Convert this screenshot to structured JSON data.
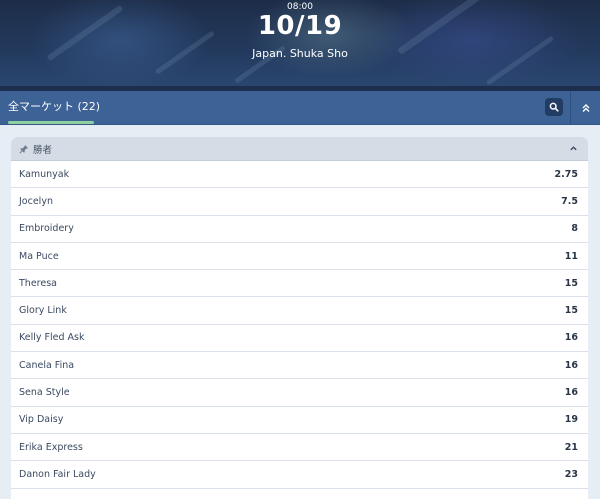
{
  "event": {
    "time": "08:00",
    "date": "10/19",
    "title": "Japan. Shuka Sho"
  },
  "market_bar": {
    "tab_label": "全マーケット (22)",
    "search_icon": "search-icon",
    "collapse_icon": "double-chevron-up-icon"
  },
  "group": {
    "pin_icon": "pin-icon",
    "title": "勝者",
    "toggle_icon": "chevron-up-icon",
    "rows": [
      {
        "name": "Kamunyak",
        "odds": "2.75"
      },
      {
        "name": "Jocelyn",
        "odds": "7.5"
      },
      {
        "name": "Embroidery",
        "odds": "8"
      },
      {
        "name": "Ma Puce",
        "odds": "11"
      },
      {
        "name": "Theresa",
        "odds": "15"
      },
      {
        "name": "Glory Link",
        "odds": "15"
      },
      {
        "name": "Kelly Fled Ask",
        "odds": "16"
      },
      {
        "name": "Canela Fina",
        "odds": "16"
      },
      {
        "name": "Sena Style",
        "odds": "16"
      },
      {
        "name": "Vip Daisy",
        "odds": "19"
      },
      {
        "name": "Erika Express",
        "odds": "21"
      },
      {
        "name": "Danon Fair Lady",
        "odds": "23"
      },
      {
        "name": "",
        "odds": ""
      }
    ]
  },
  "colors": {
    "header_bar": "#3d6296",
    "tab_underline": "#8fd19e",
    "group_header": "#d6dce5",
    "page_bg": "#e7edf4"
  }
}
